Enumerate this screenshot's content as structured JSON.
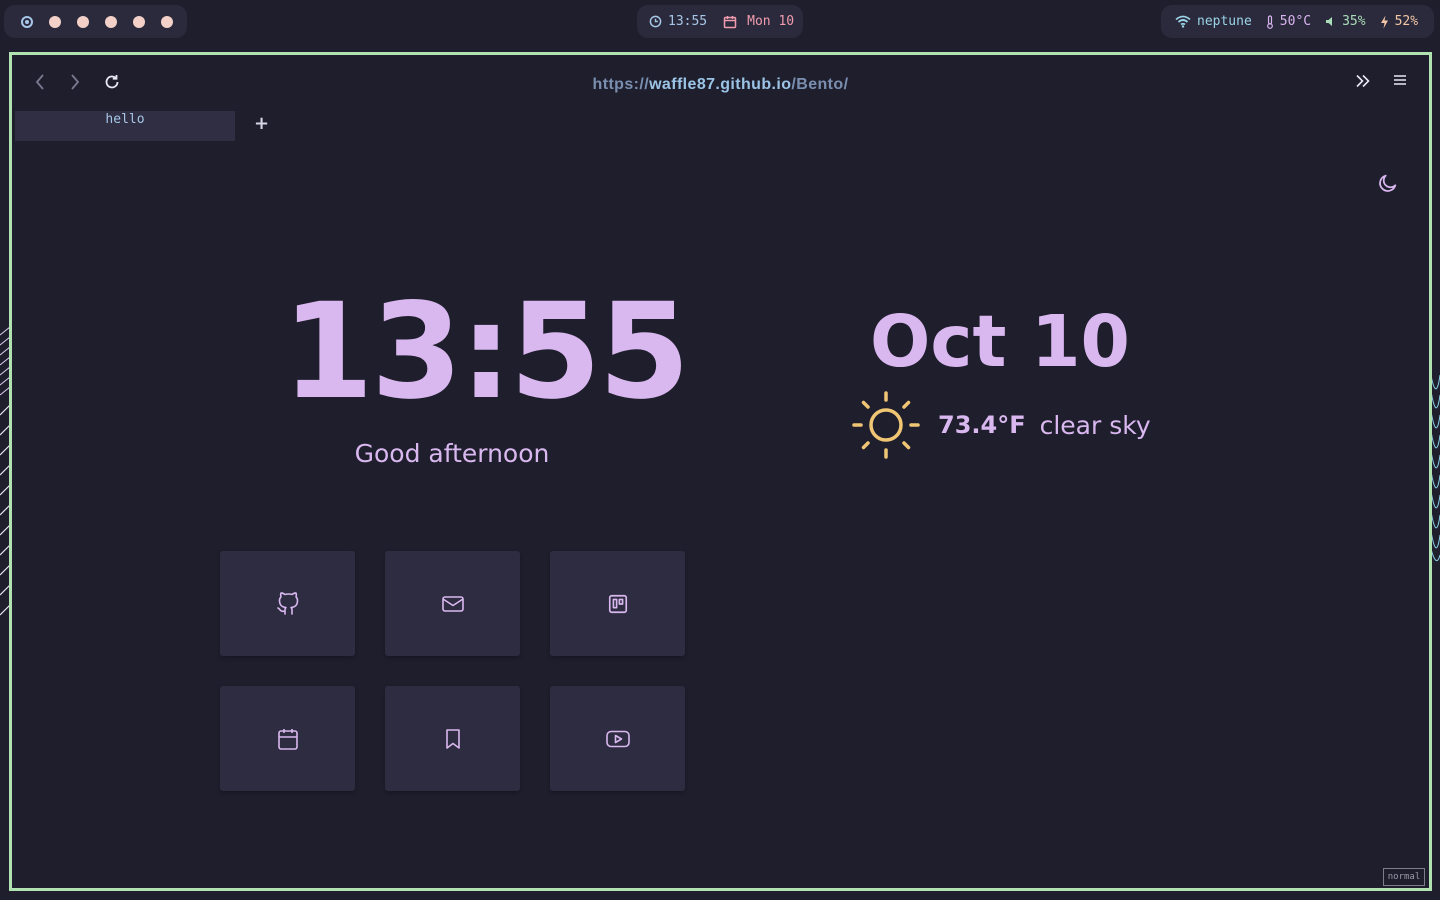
{
  "statusbar": {
    "time": "13:55",
    "date": "Mon 10",
    "network": "neptune",
    "temperature": "50°C",
    "volume": "35%",
    "battery": "52%"
  },
  "browser": {
    "url_scheme": "https://",
    "url_host": "waffle87.github.io",
    "url_path": "/Bento/",
    "tab_title": "hello",
    "new_tab_label": "+",
    "mode": "normal"
  },
  "page": {
    "clock": "13:55",
    "greeting": "Good afternoon",
    "date": "Oct 10",
    "weather_temp": "73.4°F",
    "weather_desc": "clear sky"
  },
  "links": [
    {
      "icon": "github-icon"
    },
    {
      "icon": "mail-icon"
    },
    {
      "icon": "trello-icon"
    },
    {
      "icon": "calendar-icon"
    },
    {
      "icon": "bookmark-icon"
    },
    {
      "icon": "youtube-icon"
    }
  ],
  "colors": {
    "accent": "#d9b8ef",
    "frame_border": "#b1e3b2",
    "background": "#1f1e2d",
    "sun": "#f0c674"
  }
}
